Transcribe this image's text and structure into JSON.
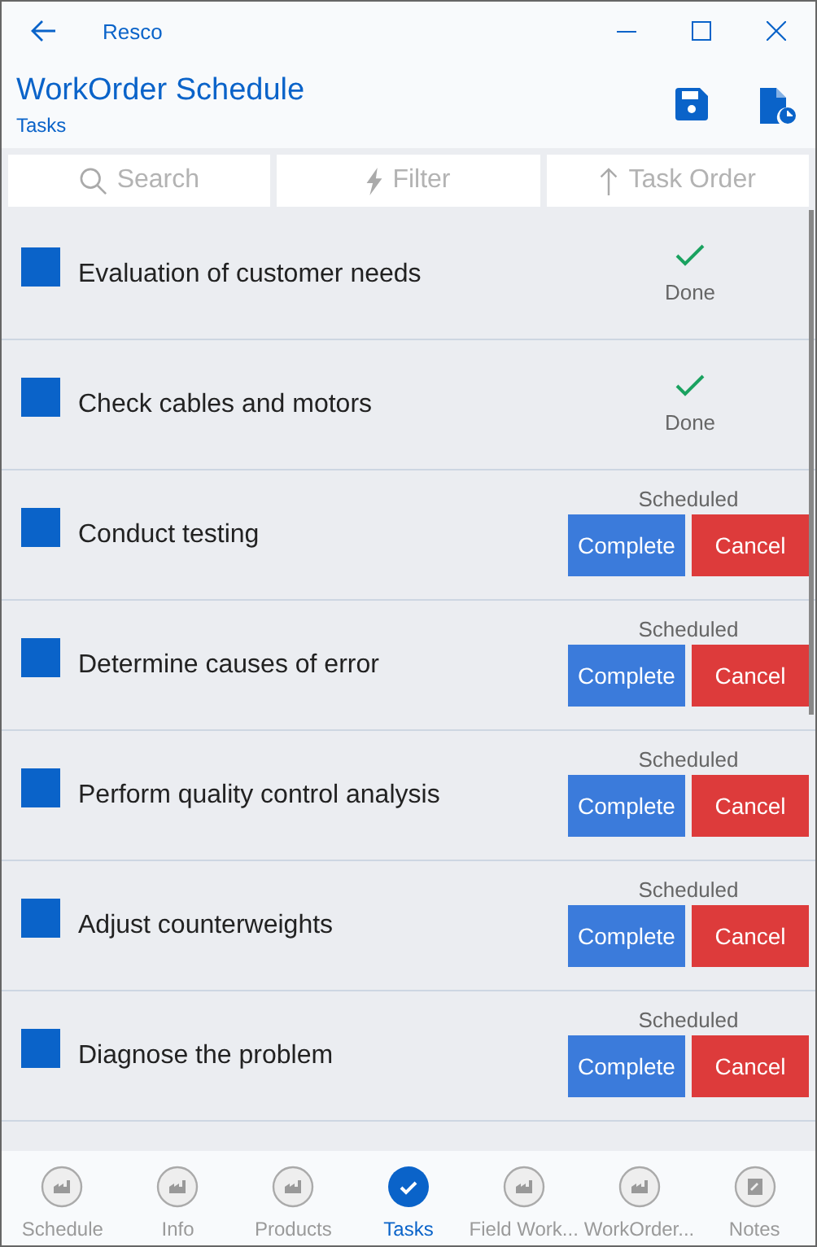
{
  "window": {
    "app_name": "Resco"
  },
  "header": {
    "title": "WorkOrder Schedule",
    "subtitle": "Tasks"
  },
  "toolbar": [
    {
      "kind": "search",
      "label": "Search"
    },
    {
      "kind": "filter",
      "label": "Filter"
    },
    {
      "kind": "sort",
      "label": "Task Order"
    }
  ],
  "tasks": [
    {
      "name": "Evaluation of customer needs",
      "kind": "done",
      "status": "Done"
    },
    {
      "name": "Check cables and motors",
      "kind": "done",
      "status": "Done"
    },
    {
      "name": "Conduct testing",
      "kind": "scheduled",
      "status": "Scheduled",
      "actions": [
        "Complete",
        "Cancel"
      ]
    },
    {
      "name": "Determine causes of error",
      "kind": "scheduled",
      "status": "Scheduled",
      "actions": [
        "Complete",
        "Cancel"
      ]
    },
    {
      "name": "Perform quality control analysis",
      "kind": "scheduled",
      "status": "Scheduled",
      "actions": [
        "Complete",
        "Cancel"
      ]
    },
    {
      "name": "Adjust counterweights",
      "kind": "scheduled",
      "status": "Scheduled",
      "actions": [
        "Complete",
        "Cancel"
      ]
    },
    {
      "name": "Diagnose the problem",
      "kind": "scheduled",
      "status": "Scheduled",
      "actions": [
        "Complete",
        "Cancel"
      ]
    }
  ],
  "tabs": [
    {
      "label": "Schedule",
      "kind": "chart",
      "selected": false
    },
    {
      "label": "Info",
      "kind": "chart",
      "selected": false
    },
    {
      "label": "Products",
      "kind": "chart",
      "selected": false
    },
    {
      "label": "Tasks",
      "kind": "check",
      "selected": true
    },
    {
      "label": "Field Work...",
      "kind": "chart",
      "selected": false
    },
    {
      "label": "WorkOrder...",
      "kind": "chart",
      "selected": false
    },
    {
      "label": "Notes",
      "kind": "clipboard",
      "selected": false
    }
  ]
}
